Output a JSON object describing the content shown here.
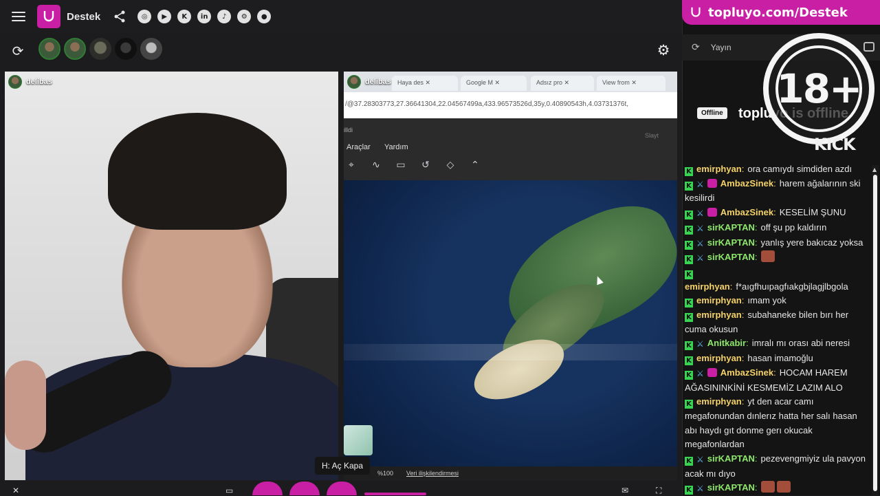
{
  "header": {
    "brand": "Destek",
    "socials": [
      "instagram-icon",
      "youtube-icon",
      "kick-icon",
      "linkedin-icon",
      "tiktok-icon",
      "steam-icon",
      "github-icon"
    ],
    "accent": "#c81fa4"
  },
  "streams": {
    "left": {
      "username": "delibas"
    },
    "right": {
      "username": "delibas"
    }
  },
  "browser": {
    "tabs": [
      "Haya des",
      "Google M",
      "Adsız pro",
      "View from"
    ],
    "url": "/@37.28303773,27.36641304,22.04567499a,433.96573526d,35y,0.40890543h,4.03731376t,"
  },
  "map": {
    "crumb": "illdi",
    "menu": [
      "Araçlar",
      "Yardım"
    ],
    "side": "Slayt",
    "zoom": "%100",
    "link": "Veri ilişkilendirmesi"
  },
  "tooltip": "H: Aç Kapa",
  "promo": {
    "text": "topluyo.com/Destek"
  },
  "chatHeader": {
    "title": "Yayın"
  },
  "badge": "18+",
  "offline": {
    "badge": "Offline",
    "title": "topluyo is offline",
    "kick": "KICK"
  },
  "chat": {
    "colors": {
      "user_yellow": "#f5d36a",
      "user_green": "#8ee86b",
      "user_blue": "#9ed4ff"
    },
    "messages": [
      {
        "user": "emirphyan",
        "text": "ora camıydı simdiden azdı",
        "k": true,
        "sw": false,
        "sub": false,
        "color": "#f5d36a"
      },
      {
        "user": "AmbazSinek",
        "text": "harem ağalarının ski kesilirdi",
        "k": true,
        "sw": true,
        "sub": true,
        "color": "#f5d36a"
      },
      {
        "user": "AmbazSinek",
        "text": "KESELİM ŞUNU",
        "k": true,
        "sw": true,
        "sub": true,
        "color": "#f5d36a"
      },
      {
        "user": "sirKAPTAN",
        "text": "off şu pp kaldırın",
        "k": true,
        "sw": true,
        "sub": false,
        "color": "#8ee86b"
      },
      {
        "user": "sirKAPTAN",
        "text": "yanlış yere bakıcaz yoksa",
        "k": true,
        "sw": true,
        "sub": false,
        "color": "#8ee86b"
      },
      {
        "user": "sirKAPTAN",
        "text": "",
        "k": true,
        "sw": true,
        "sub": false,
        "color": "#8ee86b",
        "emote": true
      },
      {
        "user": "emirphyan",
        "text": "f*aıgfhuıpagfıakgbjlagjlbgola",
        "k": true,
        "sw": false,
        "sub": false,
        "color": "#f5d36a",
        "break": true
      },
      {
        "user": "emirphyan",
        "text": "ımam yok",
        "k": true,
        "sw": false,
        "sub": false,
        "color": "#f5d36a"
      },
      {
        "user": "emirphyan",
        "text": "subahaneke bilen bırı her cuma okusun",
        "k": true,
        "sw": false,
        "sub": false,
        "color": "#f5d36a"
      },
      {
        "user": "Anitkabir",
        "text": "imralı mı orası abi neresi",
        "k": true,
        "sw": true,
        "sub": false,
        "color": "#8ee86b"
      },
      {
        "user": "emirphyan",
        "text": "hasan imamoğlu",
        "k": true,
        "sw": false,
        "sub": false,
        "color": "#f5d36a"
      },
      {
        "user": "AmbazSinek",
        "text": "HOCAM HAREM AĞASININKİNİ KESMEMİZ LAZIM ALO",
        "k": true,
        "sw": true,
        "sub": true,
        "color": "#f5d36a"
      },
      {
        "user": "emirphyan",
        "text": "yt den acar camı megafonundan dınlerız hatta her salı hasan abı haydı gıt donme gerı okucak megafonlardan",
        "k": true,
        "sw": false,
        "sub": false,
        "color": "#f5d36a"
      },
      {
        "user": "sirKAPTAN",
        "text": "pezevengmiyiz ula pavyon acak mı dıyo",
        "k": true,
        "sw": true,
        "sub": false,
        "color": "#8ee86b"
      },
      {
        "user": "sirKAPTAN",
        "text": "",
        "k": true,
        "sw": true,
        "sub": false,
        "color": "#8ee86b",
        "emote": true,
        "emote2": true
      }
    ]
  }
}
